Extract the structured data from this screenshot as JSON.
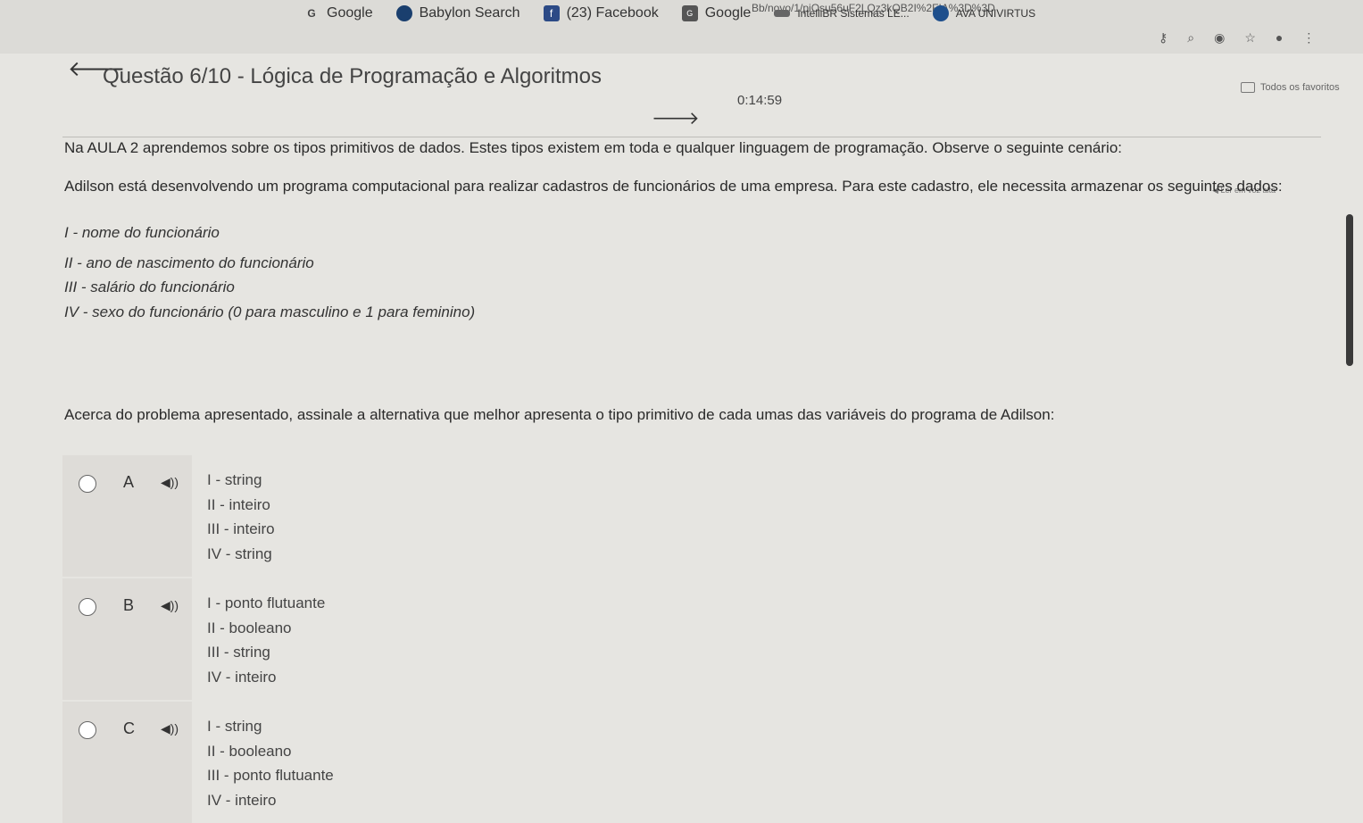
{
  "browser": {
    "url": "Bb/novo/1/piOsu56uF2LQz3kQB2I%2FIA%3D%3D",
    "bookmarks": [
      {
        "label": "Google",
        "icon": "google-icon"
      },
      {
        "label": "Babylon Search",
        "icon": "babylon-icon"
      },
      {
        "label": "(23) Facebook",
        "icon": "facebook-icon"
      },
      {
        "label": "Google",
        "icon": "google-icon"
      },
      {
        "label": "IntelliBR Sistemas LE...",
        "icon": "intellibr-icon"
      },
      {
        "label": "AVA UNIVIRTUS",
        "icon": "univirtus-icon"
      }
    ],
    "favorites_label": "Todos os favoritos"
  },
  "header": {
    "title": "Questão 6/10 - Lógica de Programação e Algoritmos",
    "timer": "0:14:59"
  },
  "listen_label": "Ler em voz alta",
  "statement": {
    "intro": "Na AULA 2 aprendemos sobre os tipos primitivos de dados. Estes tipos existem em toda e qualquer linguagem de programação. Observe o seguinte cenário:",
    "scenario": "Adilson está desenvolvendo um programa computacional para realizar cadastros de funcionários de uma empresa. Para este cadastro, ele necessita armazenar os seguintes dados:",
    "items": [
      "I - nome do funcionário",
      "II - ano de nascimento do funcionário",
      "III - salário do funcionário",
      "IV - sexo do funcionário (0 para masculino e 1 para feminino)"
    ],
    "question": "Acerca do problema apresentado, assinale a alternativa que melhor apresenta o tipo primitivo de cada umas das variáveis do programa de Adilson:"
  },
  "options": [
    {
      "letter": "A",
      "lines": [
        "I - string",
        "II - inteiro",
        "III - inteiro",
        "IV - string"
      ]
    },
    {
      "letter": "B",
      "lines": [
        "I -  ponto flutuante",
        "II - booleano",
        "III - string",
        "IV - inteiro"
      ]
    },
    {
      "letter": "C",
      "lines": [
        "I - string",
        "II - booleano",
        "III - ponto flutuante",
        "IV - inteiro"
      ]
    }
  ]
}
